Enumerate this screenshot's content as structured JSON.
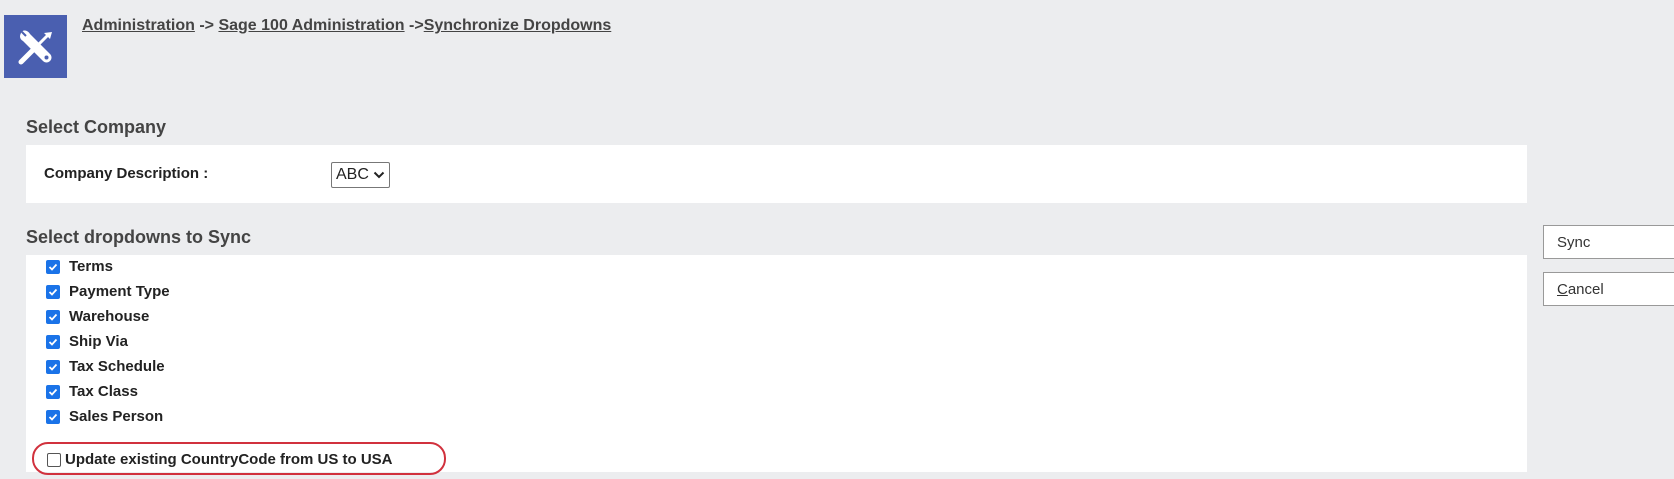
{
  "breadcrumb": {
    "item1": "Administration",
    "sep1": " -> ",
    "item2": "Sage 100 Administration",
    "sep2": " ->",
    "item3": "Synchronize Dropdowns"
  },
  "app_icon": "tools-icon",
  "company_section": {
    "title": "Select Company",
    "label": "Company Description :",
    "selected": "ABC"
  },
  "sync_section": {
    "title": "Select dropdowns to Sync",
    "items": [
      {
        "label": "Terms",
        "checked": true
      },
      {
        "label": "Payment Type",
        "checked": true
      },
      {
        "label": "Warehouse",
        "checked": true
      },
      {
        "label": "Ship Via",
        "checked": true
      },
      {
        "label": "Tax Schedule",
        "checked": true
      },
      {
        "label": "Tax Class",
        "checked": true
      },
      {
        "label": "Sales Person",
        "checked": true
      }
    ],
    "country_code": {
      "label": "Update existing CountryCode from US to USA",
      "checked": false
    }
  },
  "buttons": {
    "sync": "Sync",
    "cancel_first": "C",
    "cancel_rest": "ancel"
  },
  "colors": {
    "accent": "#1a73e8",
    "icon_bg": "#4a5fb0",
    "highlight": "#d1313d"
  }
}
